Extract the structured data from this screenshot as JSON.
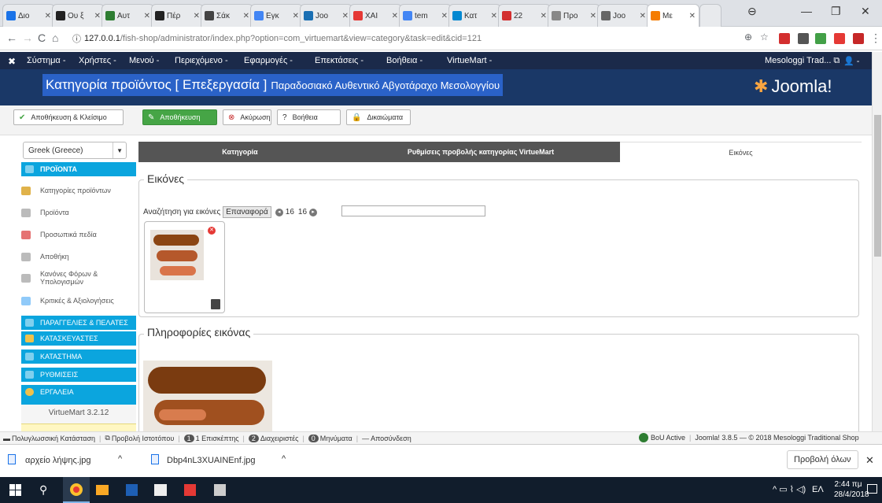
{
  "browser": {
    "tabs": [
      {
        "label": "Διο",
        "color": "#1a73e8"
      },
      {
        "label": "Ου ξ",
        "color": "#222"
      },
      {
        "label": "Αυτ",
        "color": "#2e7d32"
      },
      {
        "label": "Πέρ",
        "color": "#222"
      },
      {
        "label": "Σάκ",
        "color": "#444"
      },
      {
        "label": "Εγκ",
        "color": "#4285f4"
      },
      {
        "label": "Joo",
        "color": "#1a6fb3"
      },
      {
        "label": "ΧΑΙ",
        "color": "#e53935"
      },
      {
        "label": "tem",
        "color": "#4285f4"
      },
      {
        "label": "Κατ",
        "color": "#0288d1"
      },
      {
        "label": "22",
        "color": "#d32f2f"
      },
      {
        "label": "Προ",
        "color": "#888"
      },
      {
        "label": "Joo",
        "color": "#666"
      },
      {
        "label": "Με",
        "color": "#f57c00"
      }
    ],
    "url_host": "127.0.0.1",
    "url_path": "/fish-shop/administrator/index.php?option=com_virtuemart&view=category&task=edit&cid=121"
  },
  "topmenu": {
    "items": [
      "Σύστημα -",
      "Χρήστες -",
      "Μενού -",
      "Περιεχόμενο -",
      "Εφαρμογές -",
      "Επεκτάσεις -",
      "Βοήθεια -",
      "VirtueMart -"
    ],
    "site": "Mesologgi Trad... ⧉"
  },
  "header": {
    "title_prefix": "Κατηγορία προϊόντος",
    "title_action": "[ Επεξεργασία ]",
    "title_name": "Παραδοσιακό Αυθεντικό Αβγοτάραχο Μεσολογγίου",
    "logo": "Joomla!"
  },
  "toolbar": {
    "save_close": "Αποθήκευση & Κλείσιμο",
    "save": "Αποθήκευση",
    "cancel": "Ακύρωση",
    "help": "Βοήθεια",
    "permissions": "Δικαιώματα"
  },
  "sidebar": {
    "language": "Greek (Greece)",
    "products_header": "ΠΡΟΪΟΝΤΑ",
    "items": [
      "Κατηγορίες προϊόντων",
      "Προϊόντα",
      "Προσωπικά πεδία",
      "Αποθήκη",
      "Κανόνες Φόρων & Υπολογισμών",
      "Κριτικές & Αξιολογήσεις"
    ],
    "sections": [
      "ΠΑΡΑΓΓΕΛΙΕΣ & ΠΕΛΑΤΕΣ",
      "ΚΑΤΑΣΚΕΥΑΣΤΕΣ",
      "ΚΑΤΑΣΤΗΜΑ",
      "ΡΥΘΜΙΣΕΙΣ",
      "ΕΡΓΑΛΕΙΑ"
    ],
    "version": "VirtueMart 3.2.12"
  },
  "tabs": [
    "Κατηγορία",
    "Ρυθμίσεις προβολής κατηγορίας VirtueMart",
    "Εικόνες"
  ],
  "images": {
    "legend": "Εικόνες",
    "search_label": "Αναζήτηση για εικόνες",
    "reset": "Επαναφορά",
    "count_a": "16",
    "count_b": "16",
    "info_legend": "Πληροφορίες εικόνας"
  },
  "status": {
    "multilang": "Πολυγλωσσική Κατάσταση",
    "preview": "Προβολή Ιστοτόπου",
    "visitors_n": "1",
    "visitors": "Επισκέπτης",
    "admins_n": "2",
    "admins": "Διαχειριστές",
    "messages_n": "0",
    "messages": "Μηνύματα",
    "logout": "Αποσύνδεση",
    "bou": "BoU Active",
    "footer": "Joomla! 3.8.5 — © 2018 Mesologgi Traditional Shop"
  },
  "downloads": {
    "file1": "αρχείο λήψης.jpg",
    "file2": "Dbp4nL3XUAINEnf.jpg",
    "show_all": "Προβολή όλων"
  },
  "taskbar": {
    "lang": "ΕΛ",
    "time": "2:44 πμ",
    "date": "28/4/2018"
  },
  "colors": {
    "accent": "#0ba5de",
    "header": "#1a3867",
    "green": "#46a546"
  }
}
